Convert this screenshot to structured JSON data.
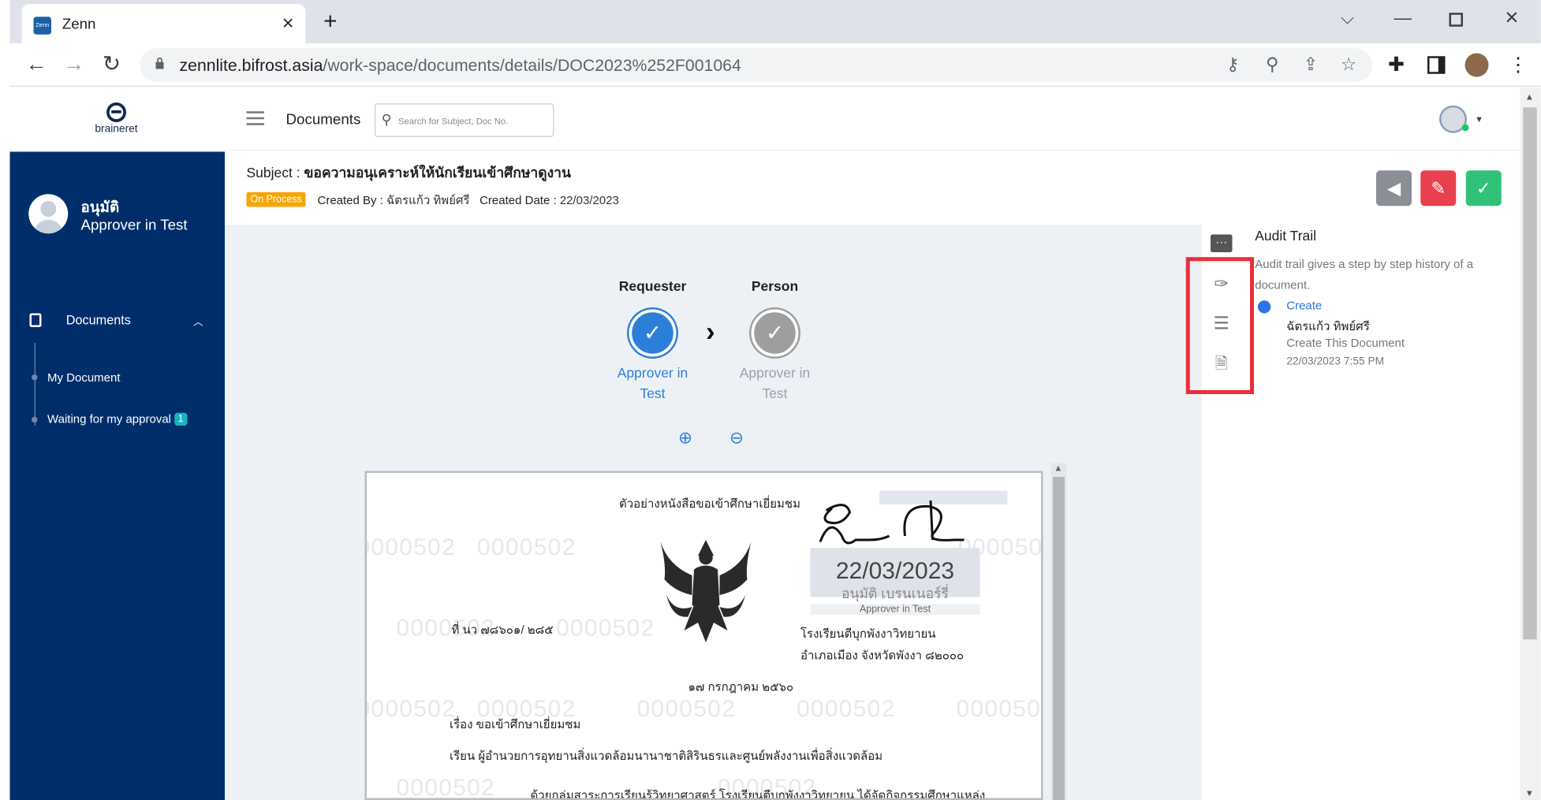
{
  "browser": {
    "tab_title": "Zenn",
    "tab_favicon_text": "Zenn",
    "url_host": "zennlite.bifrost.asia",
    "url_path": "/work-space/documents/details/DOC2023%252F001064"
  },
  "header": {
    "logo_text": "braineret",
    "page_title": "Documents",
    "search_placeholder": "Search for Subject, Doc No."
  },
  "sidebar": {
    "user_name": "อนุมัติ",
    "user_role": "Approver in Test",
    "section_label": "Documents",
    "items": [
      {
        "label": "My Document"
      },
      {
        "label": "Waiting for my approval",
        "badge": "1"
      }
    ]
  },
  "document": {
    "subject_label": "Subject :",
    "subject": "ขอความอนุเคราะห์ให้นักเรียนเข้าศึกษาดูงาน",
    "status": "On Process",
    "created_by_label": "Created By :",
    "created_by": "ฉัตรแก้ว ทิพย์ศรี",
    "created_date_label": "Created Date :",
    "created_date": "22/03/2023"
  },
  "workflow": {
    "steps": [
      {
        "name": "Requester",
        "role_line1": "Approver in",
        "role_line2": "Test",
        "state": "done"
      },
      {
        "name": "Person",
        "role_line1": "Approver in",
        "role_line2": "Test",
        "state": "pending"
      }
    ]
  },
  "paper": {
    "heading": "ตัวอย่างหนังสือขอเข้าศึกษาเยี่ยมชม",
    "ref_no": "ที่ นว ๗๘๖๐๑/ ๒๘๕",
    "school": "โรงเรียนตีบุกพังงาวิทยายน",
    "address": "อำเภอเมือง จังหวัดพังงา ๘๒๐๐๐",
    "date": "๑๗ กรกฎาคม ๒๕๖๐",
    "subject_line": "เรื่อง  ขอเข้าศึกษาเยี่ยมชม",
    "to_line": "เรียน  ผู้อำนวยการอุทยานสิ่งแวดล้อมนานาชาติสิรินธรและศูนย์พลังงานเพื่อสิ่งแวดล้อม",
    "body_line": "ด้วยกลุ่มสาระการเรียนรู้วิทยาศาสตร์ โรงเรียนตีบุกพังงาวิทยายน ได้จัดกิจกรรมศึกษาแหล่ง",
    "watermark": "0000502",
    "stamp_date": "22/03/2023",
    "stamp_name": "อนุมัติ เบรนเนอร์รี่",
    "stamp_role": "Approver in Test"
  },
  "audit": {
    "title": "Audit Trail",
    "description": "Audit trail gives a step by step history of a document.",
    "entries": [
      {
        "action": "Create",
        "user": "ฉัตรแก้ว ทิพย์ศรี",
        "note": "Create This Document",
        "time": "22/03/2023 7:55 PM"
      }
    ]
  },
  "colors": {
    "sidebar_bg": "#002e6b",
    "status_badge": "#f6a609",
    "step_done": "#2c7fd8",
    "step_pending": "#9e9e9e",
    "btn_back": "#8a8f96",
    "btn_reject": "#e8414d",
    "btn_approve": "#30c27b",
    "highlight_box": "#ea2e3c"
  }
}
